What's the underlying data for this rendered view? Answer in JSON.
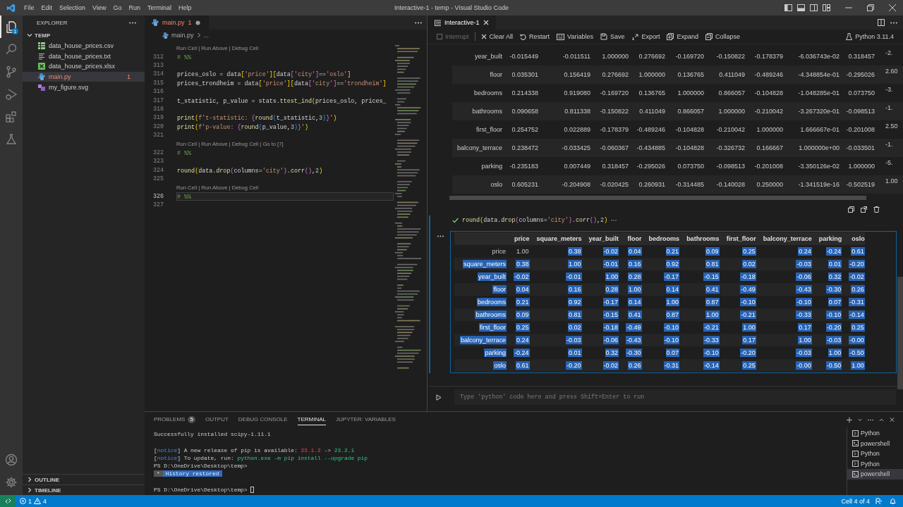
{
  "title_bar": {
    "menu": [
      "File",
      "Edit",
      "Selection",
      "View",
      "Go",
      "Run",
      "Terminal",
      "Help"
    ],
    "title": "Interactive-1 - temp - Visual Studio Code"
  },
  "activity_bar": {
    "top": [
      {
        "kind": "explorer",
        "selected": true,
        "badge": "1"
      },
      {
        "kind": "search",
        "selected": false
      },
      {
        "kind": "source-control",
        "selected": false
      },
      {
        "kind": "run-debug",
        "selected": false
      },
      {
        "kind": "extensions",
        "selected": false
      },
      {
        "kind": "testing",
        "selected": false
      }
    ],
    "bottom": [
      {
        "kind": "account"
      },
      {
        "kind": "settings"
      }
    ]
  },
  "explorer": {
    "title": "EXPLORER",
    "folder": {
      "name": "TEMP",
      "expanded": true,
      "files": [
        {
          "name": "data_house_prices.csv",
          "kind": "csv",
          "selected": false,
          "has_errors": false
        },
        {
          "name": "data_house_prices.txt",
          "kind": "txt",
          "selected": false,
          "has_errors": false
        },
        {
          "name": "data_house_prices.xlsx",
          "kind": "xlsx",
          "selected": false,
          "has_errors": false
        },
        {
          "name": "main.py",
          "kind": "py",
          "selected": true,
          "has_errors": true,
          "problems": "1"
        },
        {
          "name": "my_figure.svg",
          "kind": "svg",
          "selected": false,
          "has_errors": false
        }
      ]
    },
    "sections": [
      {
        "name": "OUTLINE",
        "expanded": false
      },
      {
        "name": "TIMELINE",
        "expanded": false
      }
    ]
  },
  "editor": {
    "tab": {
      "name": "main.py",
      "problems": "1",
      "modified": true,
      "has_errors": true
    },
    "breadcrumb": "main.py",
    "breadcrumb_more": "...",
    "lines": [
      {
        "kind": "lens",
        "text": "Run Cell | Run Above | Debug Cell"
      },
      {
        "kind": "code",
        "number": "312",
        "current": false,
        "tokens": [
          {
            "text": "# %%",
            "kind": "comment"
          }
        ]
      },
      {
        "kind": "code",
        "number": "313",
        "current": false
      },
      {
        "kind": "code",
        "number": "314",
        "current": false,
        "tokens": [
          {
            "text": "prices_oslo = data",
            "kind": "plain"
          },
          {
            "text": "[",
            "kind": "bracket1"
          },
          {
            "text": "'price'",
            "kind": "string"
          },
          {
            "text": "]",
            "kind": "bracket1"
          },
          {
            "text": "[",
            "kind": "bracket1"
          },
          {
            "text": "data",
            "kind": "plain"
          },
          {
            "text": "[",
            "kind": "bracket2"
          },
          {
            "text": "'city'",
            "kind": "string"
          },
          {
            "text": "]",
            "kind": "bracket2"
          },
          {
            "text": "==",
            "kind": "plain"
          },
          {
            "text": "'oslo'",
            "kind": "string"
          },
          {
            "text": "]",
            "kind": "bracket1"
          }
        ]
      },
      {
        "kind": "code",
        "number": "315",
        "current": false,
        "tokens": [
          {
            "text": "prices_trondheim = data",
            "kind": "plain"
          },
          {
            "text": "[",
            "kind": "bracket1"
          },
          {
            "text": "'price'",
            "kind": "string"
          },
          {
            "text": "]",
            "kind": "bracket1"
          },
          {
            "text": "[",
            "kind": "bracket1"
          },
          {
            "text": "data",
            "kind": "plain"
          },
          {
            "text": "[",
            "kind": "bracket2"
          },
          {
            "text": "'city'",
            "kind": "string"
          },
          {
            "text": "]",
            "kind": "bracket2"
          },
          {
            "text": "==",
            "kind": "plain"
          },
          {
            "text": "'trondheim'",
            "kind": "string"
          },
          {
            "text": "]",
            "kind": "bracket1"
          }
        ]
      },
      {
        "kind": "code",
        "number": "316",
        "current": false
      },
      {
        "kind": "code",
        "number": "317",
        "current": false,
        "tokens": [
          {
            "text": "t_statistic, p_value = stats.",
            "kind": "plain"
          },
          {
            "text": "ttest_ind",
            "kind": "function"
          },
          {
            "text": "(",
            "kind": "bracket1"
          },
          {
            "text": "prices_oslo, prices_",
            "kind": "plain"
          }
        ]
      },
      {
        "kind": "code",
        "number": "318",
        "current": false
      },
      {
        "kind": "code",
        "number": "319",
        "current": false,
        "tokens": [
          {
            "text": "print",
            "kind": "function"
          },
          {
            "text": "(",
            "kind": "bracket1"
          },
          {
            "text": "f't-statistic: ",
            "kind": "string"
          },
          {
            "text": "{",
            "kind": "bracket2"
          },
          {
            "text": "round",
            "kind": "function"
          },
          {
            "text": "(",
            "kind": "bracket3"
          },
          {
            "text": "t_statistic,",
            "kind": "plain"
          },
          {
            "text": "3",
            "kind": "number"
          },
          {
            "text": ")",
            "kind": "bracket3"
          },
          {
            "text": "}",
            "kind": "bracket2"
          },
          {
            "text": "'",
            "kind": "string"
          },
          {
            "text": ")",
            "kind": "bracket1"
          }
        ]
      },
      {
        "kind": "code",
        "number": "320",
        "current": false,
        "tokens": [
          {
            "text": "print",
            "kind": "function"
          },
          {
            "text": "(",
            "kind": "bracket1"
          },
          {
            "text": "f'p-value: ",
            "kind": "string"
          },
          {
            "text": "{",
            "kind": "bracket2"
          },
          {
            "text": "round",
            "kind": "function"
          },
          {
            "text": "(",
            "kind": "bracket3"
          },
          {
            "text": "p_value,",
            "kind": "plain"
          },
          {
            "text": "3",
            "kind": "number"
          },
          {
            "text": ")",
            "kind": "bracket3"
          },
          {
            "text": "}",
            "kind": "bracket2"
          },
          {
            "text": "'",
            "kind": "string"
          },
          {
            "text": ")",
            "kind": "bracket1"
          }
        ]
      },
      {
        "kind": "code",
        "number": "321",
        "current": false
      },
      {
        "kind": "lens",
        "text": "Run Cell | Run Above | Debug Cell | Go to [7]"
      },
      {
        "kind": "code",
        "number": "322",
        "current": false,
        "tokens": [
          {
            "text": "# %%",
            "kind": "comment"
          }
        ]
      },
      {
        "kind": "code",
        "number": "323",
        "current": false
      },
      {
        "kind": "code",
        "number": "324",
        "current": false,
        "tokens": [
          {
            "text": "round",
            "kind": "function"
          },
          {
            "text": "(",
            "kind": "bracket1"
          },
          {
            "text": "data.",
            "kind": "plain"
          },
          {
            "text": "drop",
            "kind": "function"
          },
          {
            "text": "(",
            "kind": "bracket2"
          },
          {
            "text": "columns=",
            "kind": "plain"
          },
          {
            "text": "'city'",
            "kind": "string"
          },
          {
            "text": ")",
            "kind": "bracket2"
          },
          {
            "text": ".",
            "kind": "plain"
          },
          {
            "text": "corr",
            "kind": "function"
          },
          {
            "text": "()",
            "kind": "bracket2"
          },
          {
            "text": ",",
            "kind": "plain"
          },
          {
            "text": "2",
            "kind": "number"
          },
          {
            "text": ")",
            "kind": "bracket1"
          }
        ]
      },
      {
        "kind": "code",
        "number": "325",
        "current": false
      },
      {
        "kind": "lens",
        "text": "Run Cell | Run Above | Debug Cell"
      },
      {
        "kind": "code",
        "number": "326",
        "current": true,
        "tokens": [
          {
            "text": "# %%",
            "kind": "comment"
          }
        ]
      },
      {
        "kind": "code",
        "number": "327",
        "current": false
      }
    ]
  },
  "interactive": {
    "tab": {
      "name": "Interactive-1"
    },
    "kernel": "Python 3.11.4",
    "toolbar": [
      {
        "kind": "interrupt",
        "label": "Interrupt",
        "disabled": true
      },
      {
        "kind": "clear",
        "label": "Clear All",
        "disabled": false
      },
      {
        "kind": "restart",
        "label": "Restart",
        "disabled": false
      },
      {
        "kind": "variables",
        "label": "Variables",
        "disabled": false
      },
      {
        "kind": "save",
        "label": "Save",
        "disabled": false
      },
      {
        "kind": "export",
        "label": "Export",
        "disabled": false
      },
      {
        "kind": "expand",
        "label": "Expand",
        "disabled": false
      },
      {
        "kind": "collapse",
        "label": "Collapse",
        "disabled": false
      }
    ],
    "output_table_1": {
      "rows": [
        {
          "label": "year_built",
          "values": [
            "-0.015449",
            "-0.011511",
            "1.000000",
            "0.276692",
            "-0.169720",
            "-0.150822",
            "-0.178379",
            "-6.036743e-02",
            "0.318457",
            "-2."
          ]
        },
        {
          "label": "floor",
          "values": [
            "0.035301",
            "0.156419",
            "0.276692",
            "1.000000",
            "0.136765",
            "0.411049",
            "-0.489246",
            "-4.348854e-01",
            "-0.295026",
            "2.60"
          ]
        },
        {
          "label": "bedrooms",
          "values": [
            "0.214338",
            "0.919080",
            "-0.169720",
            "0.136765",
            "1.000000",
            "0.866057",
            "-0.104828",
            "-1.048285e-01",
            "0.073750",
            "-3."
          ]
        },
        {
          "label": "bathrooms",
          "values": [
            "0.090658",
            "0.811338",
            "-0.150822",
            "0.411049",
            "0.866057",
            "1.000000",
            "-0.210042",
            "-3.267320e-01",
            "-0.098513",
            "-1."
          ]
        },
        {
          "label": "first_floor",
          "values": [
            "0.254752",
            "0.022889",
            "-0.178379",
            "-0.489246",
            "-0.104828",
            "-0.210042",
            "1.000000",
            "1.666667e-01",
            "-0.201008",
            "2.50"
          ]
        },
        {
          "label": "balcony_terrace",
          "values": [
            "0.238472",
            "-0.033425",
            "-0.060367",
            "-0.434885",
            "-0.104828",
            "-0.326732",
            "0.166667",
            "1.000000e+00",
            "-0.033501",
            "-1."
          ]
        },
        {
          "label": "parking",
          "values": [
            "-0.235183",
            "0.007449",
            "0.318457",
            "-0.295026",
            "0.073750",
            "-0.098513",
            "-0.201008",
            "-3.350126e-02",
            "1.000000",
            "-5."
          ]
        },
        {
          "label": "oslo",
          "values": [
            "0.605231",
            "-0.204908",
            "-0.020425",
            "0.260931",
            "-0.314485",
            "-0.140028",
            "0.250000",
            "-1.341519e-16",
            "-0.502519",
            "1.00"
          ]
        }
      ]
    },
    "cell": {
      "succeeded": true,
      "selected": true,
      "tokens": [
        {
          "text": "round",
          "kind": "function"
        },
        {
          "text": "(",
          "kind": "bracket1"
        },
        {
          "text": "data.",
          "kind": "plain"
        },
        {
          "text": "drop",
          "kind": "function"
        },
        {
          "text": "(",
          "kind": "bracket2"
        },
        {
          "text": "columns=",
          "kind": "plain"
        },
        {
          "text": "'city'",
          "kind": "string"
        },
        {
          "text": ")",
          "kind": "bracket2"
        },
        {
          "text": ".",
          "kind": "plain"
        },
        {
          "text": "corr",
          "kind": "function"
        },
        {
          "text": "()",
          "kind": "bracket2"
        },
        {
          "text": ",",
          "kind": "plain"
        },
        {
          "text": "2",
          "kind": "number"
        },
        {
          "text": ")",
          "kind": "bracket1"
        }
      ]
    },
    "output_table_2": {
      "columns": [
        "price",
        "square_meters",
        "year_built",
        "floor",
        "bedrooms",
        "bathrooms",
        "first_floor",
        "balcony_terrace",
        "parking",
        "oslo"
      ],
      "rows": [
        {
          "label": "price",
          "label_selected": false,
          "cells": [
            {
              "v": "1.00",
              "selected": false
            },
            {
              "v": "0.38",
              "selected": true
            },
            {
              "v": "-0.02",
              "selected": true
            },
            {
              "v": "0.04",
              "selected": true
            },
            {
              "v": "0.21",
              "selected": true
            },
            {
              "v": "0.09",
              "selected": true
            },
            {
              "v": "0.25",
              "selected": true
            },
            {
              "v": "0.24",
              "selected": true
            },
            {
              "v": "-0.24",
              "selected": true
            },
            {
              "v": "0.61",
              "selected": true
            }
          ]
        },
        {
          "label": "square_meters",
          "label_selected": true,
          "cells": [
            {
              "v": "0.38",
              "selected": true
            },
            {
              "v": "1.00",
              "selected": true
            },
            {
              "v": "-0.01",
              "selected": true
            },
            {
              "v": "0.16",
              "selected": true
            },
            {
              "v": "0.92",
              "selected": true
            },
            {
              "v": "0.81",
              "selected": true
            },
            {
              "v": "0.02",
              "selected": true
            },
            {
              "v": "-0.03",
              "selected": true
            },
            {
              "v": "0.01",
              "selected": true
            },
            {
              "v": "-0.20",
              "selected": true
            }
          ]
        },
        {
          "label": "year_built",
          "label_selected": true,
          "cells": [
            {
              "v": "-0.02",
              "selected": true
            },
            {
              "v": "-0.01",
              "selected": true
            },
            {
              "v": "1.00",
              "selected": true
            },
            {
              "v": "0.28",
              "selected": true
            },
            {
              "v": "-0.17",
              "selected": true
            },
            {
              "v": "-0.15",
              "selected": true
            },
            {
              "v": "-0.18",
              "selected": true
            },
            {
              "v": "-0.06",
              "selected": true
            },
            {
              "v": "0.32",
              "selected": true
            },
            {
              "v": "-0.02",
              "selected": true
            }
          ]
        },
        {
          "label": "floor",
          "label_selected": true,
          "cells": [
            {
              "v": "0.04",
              "selected": true
            },
            {
              "v": "0.16",
              "selected": true
            },
            {
              "v": "0.28",
              "selected": true
            },
            {
              "v": "1.00",
              "selected": true
            },
            {
              "v": "0.14",
              "selected": true
            },
            {
              "v": "0.41",
              "selected": true
            },
            {
              "v": "-0.49",
              "selected": true
            },
            {
              "v": "-0.43",
              "selected": true
            },
            {
              "v": "-0.30",
              "selected": true
            },
            {
              "v": "0.26",
              "selected": true
            }
          ]
        },
        {
          "label": "bedrooms",
          "label_selected": true,
          "cells": [
            {
              "v": "0.21",
              "selected": true
            },
            {
              "v": "0.92",
              "selected": true
            },
            {
              "v": "-0.17",
              "selected": true
            },
            {
              "v": "0.14",
              "selected": true
            },
            {
              "v": "1.00",
              "selected": true
            },
            {
              "v": "0.87",
              "selected": true
            },
            {
              "v": "-0.10",
              "selected": true
            },
            {
              "v": "-0.10",
              "selected": true
            },
            {
              "v": "0.07",
              "selected": true
            },
            {
              "v": "-0.31",
              "selected": true
            }
          ]
        },
        {
          "label": "bathrooms",
          "label_selected": true,
          "cells": [
            {
              "v": "0.09",
              "selected": true
            },
            {
              "v": "0.81",
              "selected": true
            },
            {
              "v": "-0.15",
              "selected": true
            },
            {
              "v": "0.41",
              "selected": true
            },
            {
              "v": "0.87",
              "selected": true
            },
            {
              "v": "1.00",
              "selected": true
            },
            {
              "v": "-0.21",
              "selected": true
            },
            {
              "v": "-0.33",
              "selected": true
            },
            {
              "v": "-0.10",
              "selected": true
            },
            {
              "v": "-0.14",
              "selected": true
            }
          ]
        },
        {
          "label": "first_floor",
          "label_selected": true,
          "cells": [
            {
              "v": "0.25",
              "selected": true
            },
            {
              "v": "0.02",
              "selected": true
            },
            {
              "v": "-0.18",
              "selected": true
            },
            {
              "v": "-0.49",
              "selected": true
            },
            {
              "v": "-0.10",
              "selected": true
            },
            {
              "v": "-0.21",
              "selected": true
            },
            {
              "v": "1.00",
              "selected": true
            },
            {
              "v": "0.17",
              "selected": true
            },
            {
              "v": "-0.20",
              "selected": true
            },
            {
              "v": "0.25",
              "selected": true
            }
          ]
        },
        {
          "label": "balcony_terrace",
          "label_selected": true,
          "cells": [
            {
              "v": "0.24",
              "selected": true
            },
            {
              "v": "-0.03",
              "selected": true
            },
            {
              "v": "-0.06",
              "selected": true
            },
            {
              "v": "-0.43",
              "selected": true
            },
            {
              "v": "-0.10",
              "selected": true
            },
            {
              "v": "-0.33",
              "selected": true
            },
            {
              "v": "0.17",
              "selected": true
            },
            {
              "v": "1.00",
              "selected": true
            },
            {
              "v": "-0.03",
              "selected": true
            },
            {
              "v": "-0.00",
              "selected": true
            }
          ]
        },
        {
          "label": "parking",
          "label_selected": true,
          "cells": [
            {
              "v": "-0.24",
              "selected": true
            },
            {
              "v": "0.01",
              "selected": true
            },
            {
              "v": "0.32",
              "selected": true
            },
            {
              "v": "-0.30",
              "selected": true
            },
            {
              "v": "0.07",
              "selected": true
            },
            {
              "v": "-0.10",
              "selected": true
            },
            {
              "v": "-0.20",
              "selected": true
            },
            {
              "v": "-0.03",
              "selected": true
            },
            {
              "v": "1.00",
              "selected": true
            },
            {
              "v": "-0.50",
              "selected": true
            }
          ]
        },
        {
          "label": "oslo",
          "label_selected": true,
          "cells": [
            {
              "v": "0.61",
              "selected": true
            },
            {
              "v": "-0.20",
              "selected": true
            },
            {
              "v": "-0.02",
              "selected": true
            },
            {
              "v": "0.26",
              "selected": true
            },
            {
              "v": "-0.31",
              "selected": true
            },
            {
              "v": "-0.14",
              "selected": true
            },
            {
              "v": "0.25",
              "selected": true
            },
            {
              "v": "-0.00",
              "selected": true
            },
            {
              "v": "-0.50",
              "selected": true
            },
            {
              "v": "1.00",
              "selected": true
            }
          ]
        }
      ]
    },
    "input": {
      "placeholder": "Type 'python' code here and press Shift+Enter to run"
    }
  },
  "panel": {
    "tabs": [
      {
        "label": "PROBLEMS",
        "badge": "5",
        "selected": false
      },
      {
        "label": "OUTPUT",
        "selected": false
      },
      {
        "label": "DEBUG CONSOLE",
        "selected": false
      },
      {
        "label": "TERMINAL",
        "selected": true
      },
      {
        "label": "JUPYTER: VARIABLES",
        "selected": false
      }
    ],
    "terminal": [
      {
        "kind": "text",
        "cursor": false,
        "segments": [
          {
            "text": "Successfully installed scipy-1.11.1",
            "kind": "plain"
          }
        ]
      },
      {
        "kind": "blank"
      },
      {
        "kind": "text",
        "cursor": false,
        "segments": [
          {
            "text": "[",
            "kind": "plain"
          },
          {
            "text": "notice",
            "kind": "blue"
          },
          {
            "text": "] A new release of pip is available: ",
            "kind": "plain"
          },
          {
            "text": "23.1.2",
            "kind": "red"
          },
          {
            "text": " -> ",
            "kind": "plain"
          },
          {
            "text": "23.2.1",
            "kind": "green"
          }
        ]
      },
      {
        "kind": "text",
        "cursor": false,
        "segments": [
          {
            "text": "[",
            "kind": "plain"
          },
          {
            "text": "notice",
            "kind": "blue"
          },
          {
            "text": "] To update, run: ",
            "kind": "plain"
          },
          {
            "text": "python.exe -m pip install --upgrade pip",
            "kind": "green"
          }
        ]
      },
      {
        "kind": "text",
        "cursor": false,
        "segments": [
          {
            "text": "PS D:\\OneDrive\\Desktop\\temp>",
            "kind": "plain"
          }
        ]
      },
      {
        "kind": "text",
        "cursor": false,
        "segments": [
          {
            "text": "*",
            "kind": "mark"
          },
          {
            "text": "History restored",
            "kind": "highlight"
          }
        ]
      },
      {
        "kind": "blank"
      },
      {
        "kind": "text",
        "cursor": true,
        "segments": [
          {
            "text": "PS D:\\OneDrive\\Desktop\\temp>",
            "kind": "plain"
          }
        ]
      }
    ],
    "terminals": [
      {
        "name": "Python",
        "kind": "python",
        "selected": false
      },
      {
        "name": "powershell",
        "kind": "powershell",
        "selected": false
      },
      {
        "name": "Python",
        "kind": "python",
        "selected": false
      },
      {
        "name": "Python",
        "kind": "python",
        "selected": false
      },
      {
        "name": "powershell",
        "kind": "powershell",
        "selected": true
      }
    ]
  },
  "status_bar": {
    "errors": "1",
    "warnings": "4",
    "cell": "Cell 4 of 4"
  }
}
